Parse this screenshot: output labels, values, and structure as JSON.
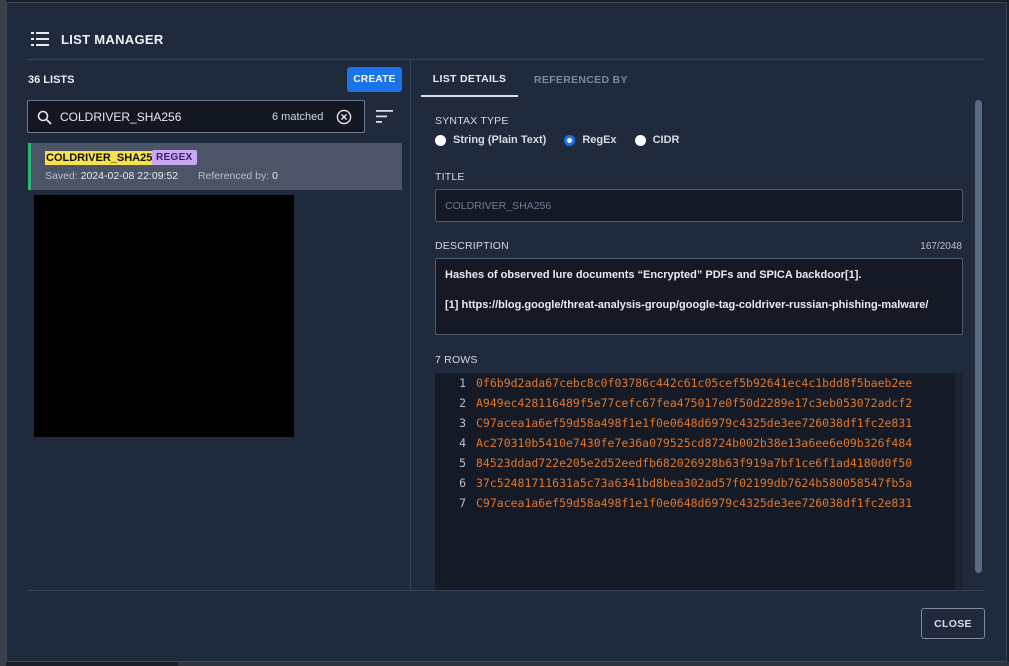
{
  "modal": {
    "title": "LIST MANAGER"
  },
  "left": {
    "count_label": "36 LISTS",
    "create_label": "CREATE",
    "search": {
      "value": "COLDRIVER_SHA256",
      "matched": "6 matched"
    },
    "items": [
      {
        "name": "COLDRIVER_SHA256",
        "badge": "REGEX",
        "saved_label": "Saved:",
        "saved_value": "2024-02-08 22:09:52",
        "ref_label": "Referenced by:",
        "ref_value": "0"
      }
    ]
  },
  "tabs": [
    {
      "label": "LIST DETAILS",
      "active": true
    },
    {
      "label": "REFERENCED BY",
      "active": false
    }
  ],
  "details": {
    "syntax_label": "SYNTAX TYPE",
    "syntax_options": [
      {
        "label": "String (Plain Text)",
        "selected": false
      },
      {
        "label": "RegEx",
        "selected": true
      },
      {
        "label": "CIDR",
        "selected": false
      }
    ],
    "title_label": "TITLE",
    "title_value": "COLDRIVER_SHA256",
    "desc_label": "DESCRIPTION",
    "desc_count": "167/2048",
    "desc_line1": "Hashes of observed lure documents “Encrypted” PDFs and SPICA backdoor[1].",
    "desc_line2": "[1] https://blog.google/threat-analysis-group/google-tag-coldriver-russian-phishing-malware/",
    "rows_label": "7 ROWS",
    "rows": [
      {
        "n": "1",
        "v": "0f6b9d2ada67cebc8c0f03786c442c61c05cef5b92641ec4c1bdd8f5baeb2ee"
      },
      {
        "n": "2",
        "v": "A949ec428116489f5e77cefc67fea475017e0f50d2289e17c3eb053072adcf2"
      },
      {
        "n": "3",
        "v": "C97acea1a6ef59d58a498f1e1f0e0648d6979c4325de3ee726038df1fc2e831"
      },
      {
        "n": "4",
        "v": "Ac270310b5410e7430fe7e36a079525cd8724b002b38e13a6ee6e09b326f484"
      },
      {
        "n": "5",
        "v": "84523ddad722e205e2d52eedfb682026928b63f919a7bf1ce6f1ad4180d0f50"
      },
      {
        "n": "6",
        "v": "37c52481711631a5c73a6341bd8bea302ad57f02199db7624b580058547fb5a"
      },
      {
        "n": "7",
        "v": "C97acea1a6ef59d58a498f1e1f0e0648d6979c4325de3ee726038df1fc2e831"
      }
    ]
  },
  "footer": {
    "close_label": "CLOSE"
  },
  "colors": {
    "accent": "#1a73e8",
    "highlight": "#f6e24a",
    "badge": "#c9a7f2",
    "hash": "#e0782a",
    "selected_bar": "#2bb673"
  }
}
